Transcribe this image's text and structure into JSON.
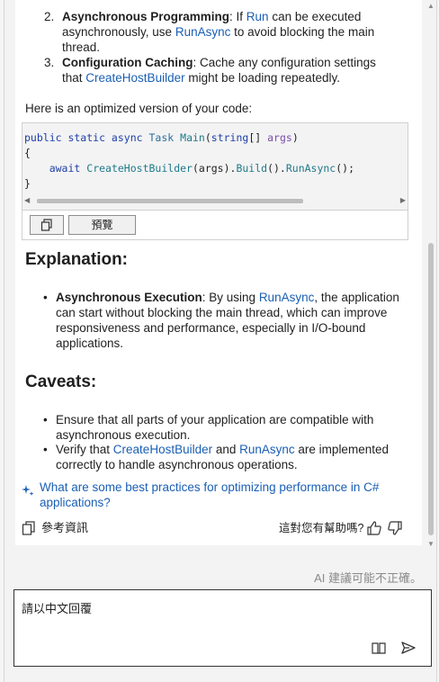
{
  "list_items": [
    {
      "num": "2.",
      "bold": "Asynchronous Programming",
      "pre": ": If ",
      "link1": "Run",
      "mid": " can be executed",
      "line2a": "asynchronously, use ",
      "link2": "RunAsync",
      "line2b": " to avoid blocking the main",
      "line3": "thread."
    },
    {
      "num": "3.",
      "bold": "Configuration Caching",
      "pre": ": Cache any configuration settings",
      "line2a": "that ",
      "link2": "CreateHostBuilder",
      "line2b": " might be loading repeatedly."
    }
  ],
  "intro_text": "Here is an optimized version of your code:",
  "code": {
    "line1": {
      "kw": "public static async",
      "ty": "Task",
      "fn": "Main",
      "rest1": "(",
      "ty2": "string",
      "rest2": "[] ",
      "arg": "args",
      "rest3": ")"
    },
    "line2": "{",
    "line3": {
      "indent": "    ",
      "kw": "await",
      "fn": "CreateHostBuilder",
      "rest1": "(args).",
      "fn2": "Build",
      "rest2": "().",
      "fn3": "RunAsync",
      "rest3": "();"
    },
    "line4": "}",
    "preview_label": "預覽"
  },
  "explanation": {
    "heading": "Explanation:",
    "bold": "Asynchronous Execution",
    "t1": ": By using ",
    "link": "RunAsync",
    "t2": ", the application",
    "l2": "can start without blocking the main thread, which can improve",
    "l3": "responsiveness and performance, especially in I/O-bound",
    "l4": "applications."
  },
  "caveats": {
    "heading": "Caveats:",
    "items": [
      {
        "l1": "Ensure that all parts of your application are compatible with",
        "l2": "asynchronous execution."
      },
      {
        "l1a": "Verify that ",
        "link1": "CreateHostBuilder",
        "l1b": " and ",
        "link2": "RunAsync",
        "l1c": " are implemented",
        "l2": "correctly to handle asynchronous operations."
      }
    ]
  },
  "suggestion": {
    "l1": "What are some best practices for optimizing performance in C#",
    "l2": "applications?"
  },
  "footer": {
    "refs_label": "參考資訊",
    "helpful_label": "這對您有幫助嗎?"
  },
  "disclaimer": "AI 建議可能不正確。",
  "input": {
    "value": "請以中文回覆"
  },
  "colors": {
    "link": "#1a5fb4",
    "keyword": "#1e3fa8",
    "background": "#f3f3f3"
  }
}
